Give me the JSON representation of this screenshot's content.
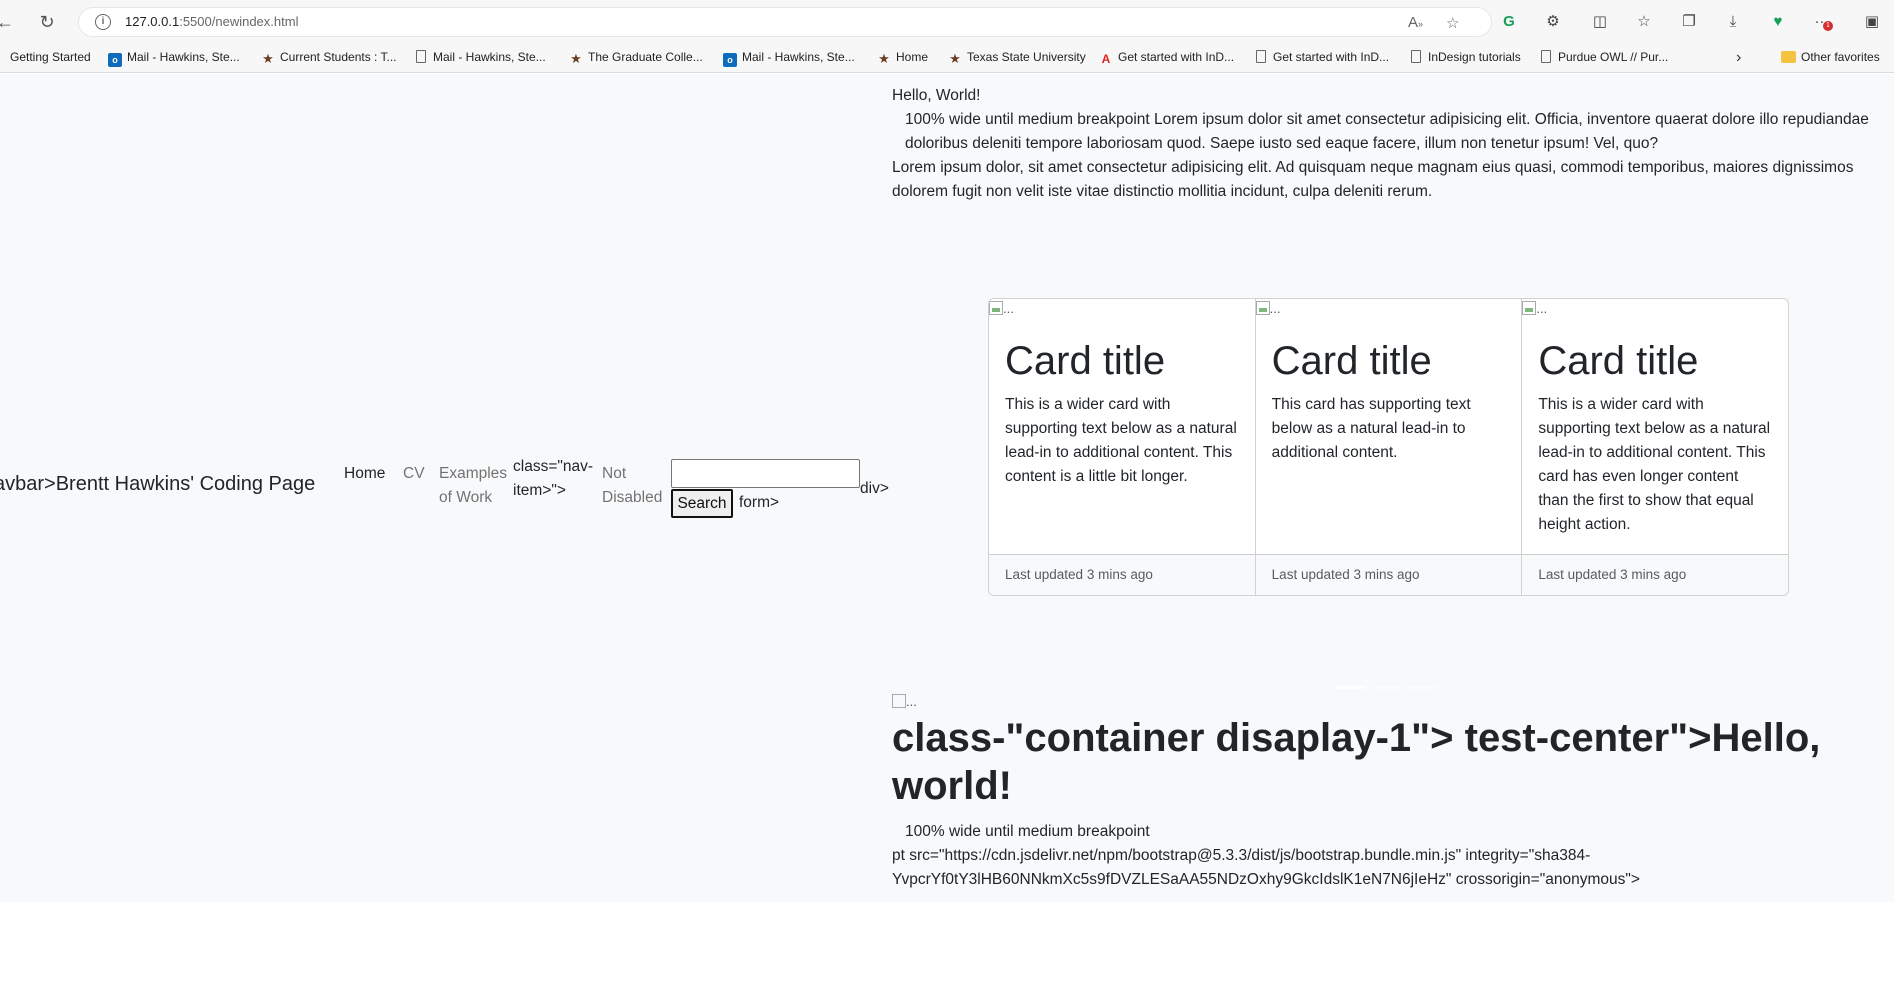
{
  "browser": {
    "url_host": "127.0.0.1",
    "url_path": ":5500/newindex.html",
    "notification_count": "1"
  },
  "bookmarks": [
    {
      "label": "Getting Started",
      "icon": "none"
    },
    {
      "label": "Mail - Hawkins, Ste...",
      "icon": "outlook-icon"
    },
    {
      "label": "Current Students : T...",
      "icon": "star-icon"
    },
    {
      "label": "Mail - Hawkins, Ste...",
      "icon": "page-icon"
    },
    {
      "label": "The Graduate Colle...",
      "icon": "star-icon"
    },
    {
      "label": "Mail - Hawkins, Ste...",
      "icon": "outlook-icon"
    },
    {
      "label": "Home",
      "icon": "star-icon"
    },
    {
      "label": "Texas State University",
      "icon": "star-icon"
    },
    {
      "label": "Get started with InD...",
      "icon": "adobe-icon"
    },
    {
      "label": "Get started with InD...",
      "icon": "page-icon"
    },
    {
      "label": "InDesign tutorials",
      "icon": "page-icon"
    },
    {
      "label": "Purdue OWL // Pur...",
      "icon": "page-icon"
    }
  ],
  "other_favorites": "Other favorites",
  "intro": {
    "hello": "Hello, World!",
    "para": "100% wide until medium breakpoint Lorem ipsum dolor sit amet consectetur adipisicing elit. Officia, inventore quaerat dolore illo repudiandae doloribus deleniti tempore laboriosam quod. Saepe iusto sed eaque facere, illum non tenetur ipsum! Vel, quo?",
    "para2": "Lorem ipsum dolor, sit amet consectetur adipisicing elit. Ad quisquam neque magnam eius quasi, commodi temporibus, maiores dignissimos dolorem fugit non velit iste vitae distinctio mollitia incidunt, culpa deleniti rerum."
  },
  "navbar": {
    "brand": "avbar>Brentt Hawkins' Coding Page",
    "home": "Home",
    "cv": "CV",
    "examples_1": "Examples",
    "examples_2": "of Work",
    "navitem_1": "class=\"nav-",
    "navitem_2": "item>\">",
    "not_disabled_1": "Not",
    "not_disabled_2": "Disabled",
    "search_value": "",
    "search_button": "Search",
    "form_close": "form>",
    "div_close": "div>"
  },
  "cards": [
    {
      "img_alt": "...",
      "title": "Card title",
      "text": "This is a wider card with supporting text below as a natural lead-in to additional content. This content is a little bit longer.",
      "footer": "Last updated 3 mins ago"
    },
    {
      "img_alt": "...",
      "title": "Card title",
      "text": "This card has supporting text below as a natural lead-in to additional content.",
      "footer": "Last updated 3 mins ago"
    },
    {
      "img_alt": "...",
      "title": "Card title",
      "text": "This is a wider card with supporting text below as a natural lead-in to additional content. This card has even longer content than the first to show that equal height action.",
      "footer": "Last updated 3 mins ago"
    }
  ],
  "bottom": {
    "img_alt": "...",
    "heading": "class-\"container disaplay-1\"> test-center\">Hello, world!",
    "line1": "100% wide until medium breakpoint",
    "line2": "pt src=\"https://cdn.jsdelivr.net/npm/bootstrap@5.3.3/dist/js/bootstrap.bundle.min.js\" integrity=\"sha384-YvpcrYf0tY3lHB60NNkmXc5s9fDVZLESaAA55NDzOxhy9GkcIdslK1eN7N6jIeHz\" crossorigin=\"anonymous\">"
  }
}
